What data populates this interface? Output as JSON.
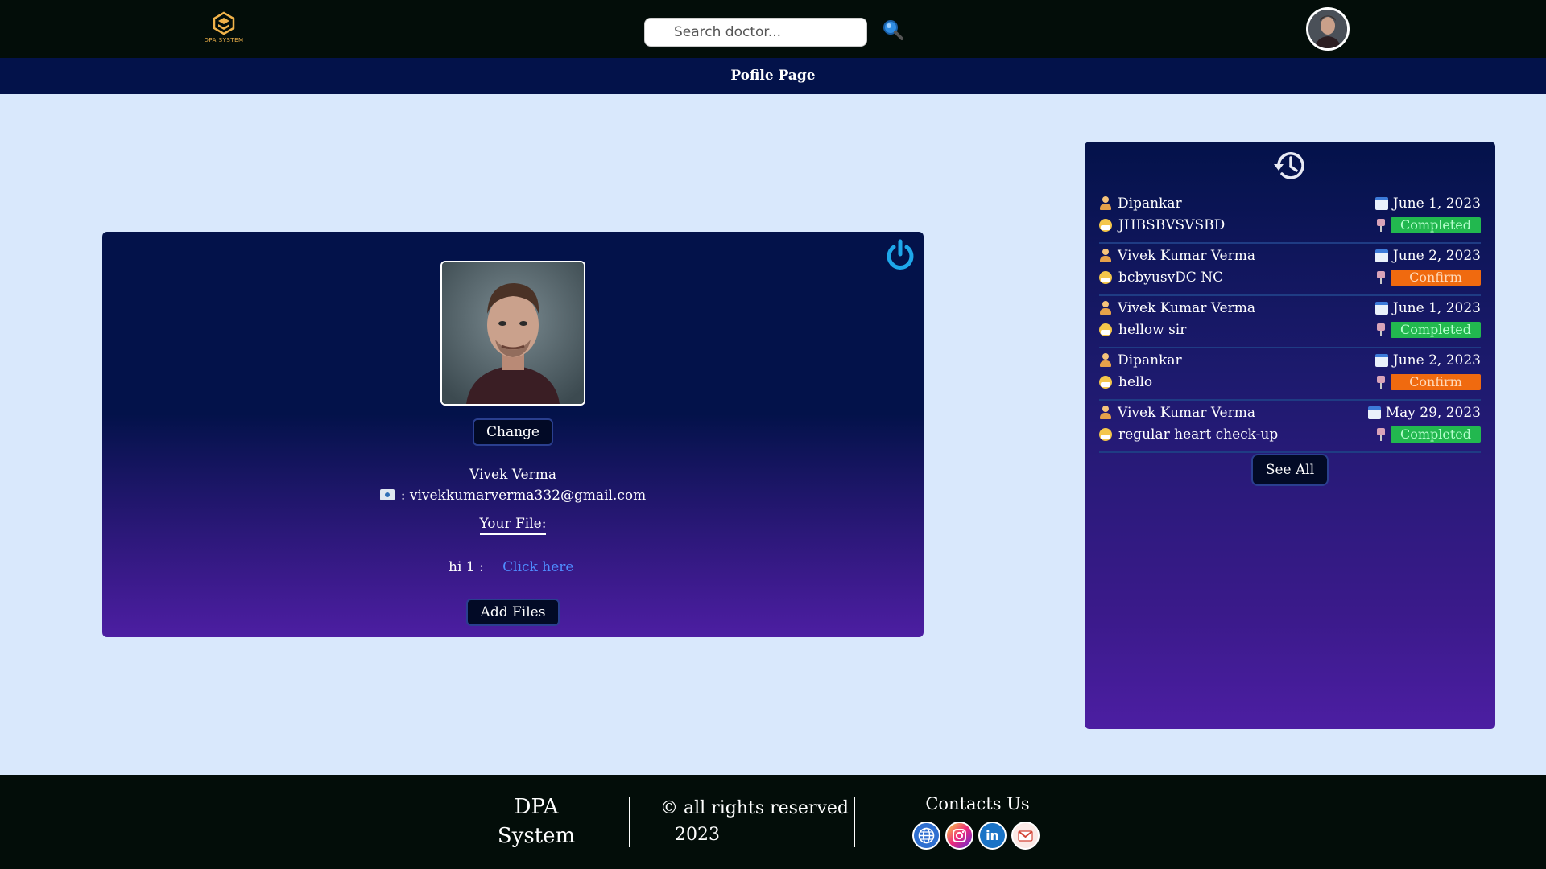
{
  "header": {
    "logo_text": "DPA SYSTEM",
    "search_placeholder": "Search doctor..."
  },
  "subheader": {
    "title": "Pofile Page"
  },
  "profile": {
    "change_label": "Change",
    "name": "Vivek Verma",
    "email": ": vivekkumarverma332@gmail.com",
    "your_file_label": "Your File:",
    "file": {
      "name": "hi 1 :",
      "link_label": "Click here"
    },
    "add_files_label": "Add Files"
  },
  "history": {
    "items": [
      {
        "doctor": "Dipankar",
        "date": "June 1, 2023",
        "title": "JHBSBVSVSBD",
        "status": "Completed",
        "status_type": "completed"
      },
      {
        "doctor": "Vivek Kumar Verma",
        "date": "June 2, 2023",
        "title": "bcbyusvDC NC",
        "status": "Confirm",
        "status_type": "confirm"
      },
      {
        "doctor": "Vivek Kumar Verma",
        "date": "June 1, 2023",
        "title": "hellow sir",
        "status": "Completed",
        "status_type": "completed"
      },
      {
        "doctor": "Dipankar",
        "date": "June 2, 2023",
        "title": "hello",
        "status": "Confirm",
        "status_type": "confirm"
      },
      {
        "doctor": "Vivek Kumar Verma",
        "date": "May 29, 2023",
        "title": "regular heart check-up",
        "status": "Completed",
        "status_type": "completed"
      }
    ],
    "see_all_label": "See All"
  },
  "footer": {
    "brand_line1": "DPA",
    "brand_line2": "System",
    "rights": "© all rights reserved",
    "year": "2023",
    "contacts_title": "Contacts Us",
    "socials": [
      "globe-icon",
      "instagram-icon",
      "linkedin-icon",
      "gmail-icon"
    ]
  },
  "colors": {
    "topbar": "#030d09",
    "subbar": "#03124a",
    "page_bg": "#d9e8fc",
    "completed": "#22b84f",
    "confirm": "#f06a0f",
    "link": "#4f8cff"
  }
}
